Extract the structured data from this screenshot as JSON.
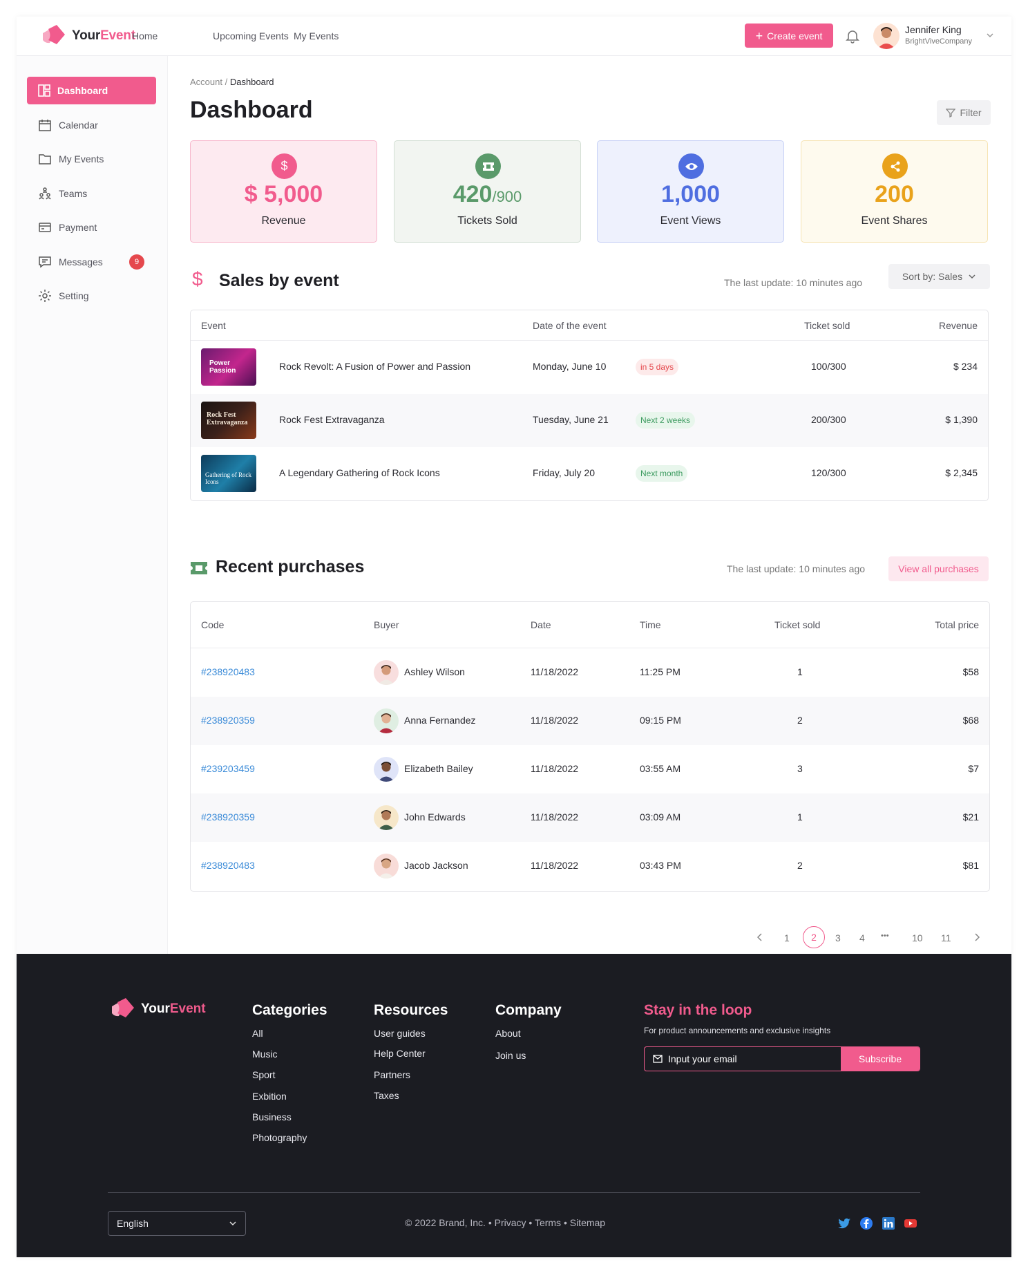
{
  "brand": {
    "name_a": "Your",
    "name_b": "Event"
  },
  "nav": {
    "home": "Home",
    "upcoming": "Upcoming Events",
    "my_events": "My Events"
  },
  "header": {
    "create_label": "Create event",
    "user_name": "Jennifer King",
    "user_company": "BrightViveCompany"
  },
  "sidebar": {
    "items": [
      {
        "label": "Dashboard",
        "icon": "dashboard-icon"
      },
      {
        "label": "Calendar",
        "icon": "calendar-icon"
      },
      {
        "label": "My Events",
        "icon": "folder-icon"
      },
      {
        "label": "Teams",
        "icon": "teams-icon"
      },
      {
        "label": "Payment",
        "icon": "payment-icon"
      },
      {
        "label": "Messages",
        "icon": "message-icon",
        "badge": "9"
      },
      {
        "label": "Setting",
        "icon": "gear-icon"
      }
    ]
  },
  "breadcrumb": {
    "parent": "Account /",
    "current": "Dashboard"
  },
  "page": {
    "title": "Dashboard",
    "filter_label": "Filter"
  },
  "stats": [
    {
      "value": "$ 5,000",
      "suffix": "",
      "label": "Revenue",
      "color": "#f15b8d",
      "bg": "#fdeaf0",
      "border": "#f7b6cb"
    },
    {
      "value": "420",
      "suffix": "/900",
      "label": "Tickets Sold",
      "color": "#5a9a6a",
      "bg": "#f2f5f1",
      "border": "#d3dfd4"
    },
    {
      "value": "1,000",
      "suffix": "",
      "label": "Event Views",
      "color": "#4f6ee0",
      "bg": "#eef1fd",
      "border": "#c7d1f6"
    },
    {
      "value": "200",
      "suffix": "",
      "label": "Event Shares",
      "color": "#e9a21b",
      "bg": "#fefaee",
      "border": "#f6e3b2"
    }
  ],
  "sales": {
    "title": "Sales by event",
    "updated": "The last update: 10 minutes ago",
    "sort_label": "Sort by: Sales",
    "headers": {
      "event": "Event",
      "date": "Date of the event",
      "sold": "Ticket sold",
      "revenue": "Revenue"
    },
    "rows": [
      {
        "name": "Rock Revolt: A Fusion of Power and Passion",
        "date": "Monday, June 10",
        "tag": "in 5 days",
        "tag_type": "red",
        "sold": "100/300",
        "revenue": "$ 234",
        "thumb_text": "Power Passion"
      },
      {
        "name": "Rock Fest Extravaganza",
        "date": "Tuesday, June 21",
        "tag": "Next 2 weeks",
        "tag_type": "green",
        "sold": "200/300",
        "revenue": "$ 1,390",
        "thumb_text": "Rock Fest Extravaganza"
      },
      {
        "name": "A Legendary Gathering of Rock Icons",
        "date": "Friday, July 20",
        "tag": "Next month",
        "tag_type": "green",
        "sold": "120/300",
        "revenue": "$ 2,345",
        "thumb_text": "Gathering of Rock Icons"
      }
    ]
  },
  "purchases": {
    "title": "Recent purchases",
    "updated": "The last update: 10 minutes ago",
    "view_all": "View all purchases",
    "headers": {
      "code": "Code",
      "buyer": "Buyer",
      "date": "Date",
      "time": "Time",
      "sold": "Ticket sold",
      "total": "Total price"
    },
    "rows": [
      {
        "code": "#238920483",
        "buyer": "Ashley Wilson",
        "date": "11/18/2022",
        "time": "11:25 PM",
        "sold": "1",
        "total": "$58"
      },
      {
        "code": "#238920359",
        "buyer": "Anna Fernandez",
        "date": "11/18/2022",
        "time": "09:15 PM",
        "sold": "2",
        "total": "$68"
      },
      {
        "code": "#239203459",
        "buyer": "Elizabeth Bailey",
        "date": "11/18/2022",
        "time": "03:55 AM",
        "sold": "3",
        "total": "$7"
      },
      {
        "code": "#238920359",
        "buyer": "John Edwards",
        "date": "11/18/2022",
        "time": "03:09 AM",
        "sold": "1",
        "total": "$21"
      },
      {
        "code": "#238920483",
        "buyer": "Jacob Jackson",
        "date": "11/18/2022",
        "time": "03:43 PM",
        "sold": "2",
        "total": "$81"
      }
    ]
  },
  "pagination": {
    "pages": [
      "1",
      "2",
      "3",
      "4",
      "•••",
      "10",
      "11"
    ],
    "current": "2"
  },
  "footer": {
    "categories": {
      "title": "Categories",
      "links": [
        "All",
        "Music",
        "Sport",
        "Exbition",
        "Business",
        "Photography"
      ]
    },
    "resources": {
      "title": "Resources",
      "links": [
        "User guides",
        "Help Center",
        "Partners",
        "Taxes"
      ]
    },
    "company": {
      "title": "Company",
      "links": [
        "About",
        "Join us"
      ]
    },
    "loop_title": "Stay in the loop",
    "loop_sub": "For product announcements and exclusive insights",
    "email_placeholder": "Input your email",
    "subscribe": "Subscribe",
    "language": "English",
    "copyright": "© 2022 Brand, Inc.  • Privacy • Terms • Sitemap"
  }
}
